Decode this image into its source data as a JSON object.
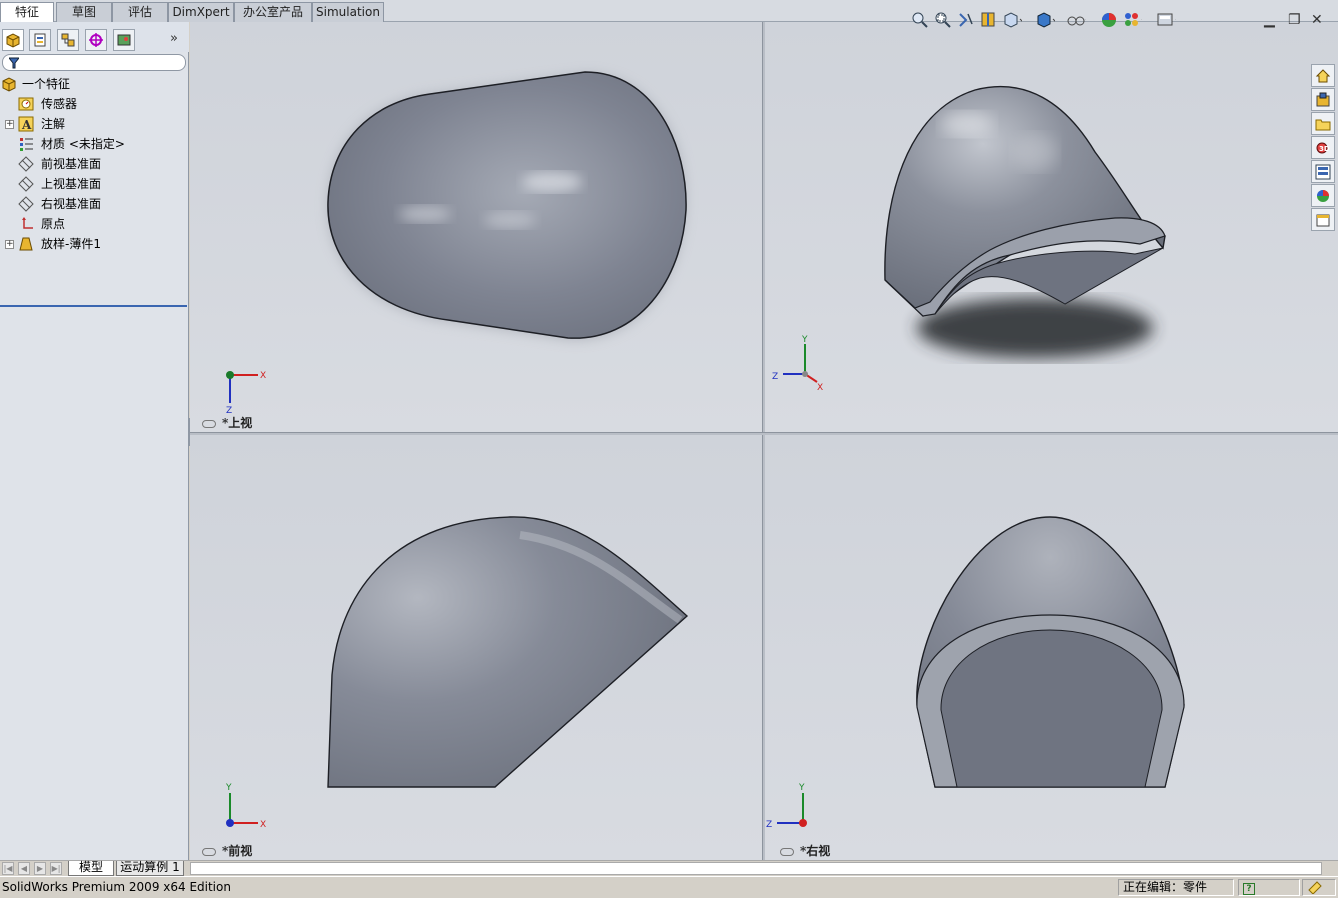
{
  "command_tabs": [
    {
      "label": "特征",
      "active": true
    },
    {
      "label": "草图",
      "active": false
    },
    {
      "label": "评估",
      "active": false
    },
    {
      "label": "DimXpert",
      "active": false
    },
    {
      "label": "办公室产品",
      "active": false
    },
    {
      "label": "Simulation",
      "active": false
    }
  ],
  "feature_manager": {
    "toolbar_icons": [
      "feature-manager-icon",
      "property-manager-icon",
      "configuration-manager-icon",
      "dimxpert-manager-icon",
      "display-manager-icon"
    ],
    "more_label": "»",
    "tree": [
      {
        "label": "一个特征",
        "icon": "part-icon",
        "root": true,
        "expandable": false
      },
      {
        "label": "传感器",
        "icon": "sensor-icon",
        "expandable": false
      },
      {
        "label": "注解",
        "icon": "annotation-icon",
        "expandable": true
      },
      {
        "label": "材质 <未指定>",
        "icon": "material-icon",
        "expandable": false
      },
      {
        "label": "前视基准面",
        "icon": "plane-icon",
        "expandable": false
      },
      {
        "label": "上视基准面",
        "icon": "plane-icon",
        "expandable": false
      },
      {
        "label": "右视基准面",
        "icon": "plane-icon",
        "expandable": false
      },
      {
        "label": "原点",
        "icon": "origin-icon",
        "expandable": false
      },
      {
        "label": "放样-薄件1",
        "icon": "loft-icon",
        "expandable": true
      }
    ]
  },
  "viewports": [
    {
      "label": "*上视"
    },
    {
      "label": "*前视"
    },
    {
      "label": "*右视"
    }
  ],
  "triad_axes": {
    "x": "X",
    "y": "Y",
    "z": "Z"
  },
  "bottom_tabs": [
    "模型",
    "运动算例 1"
  ],
  "status": {
    "app": "SolidWorks Premium 2009 x64 Edition",
    "editing": "正在编辑：零件",
    "help": "?"
  },
  "colors": {
    "accent": "#3a66b0",
    "model": "#7d828f"
  }
}
